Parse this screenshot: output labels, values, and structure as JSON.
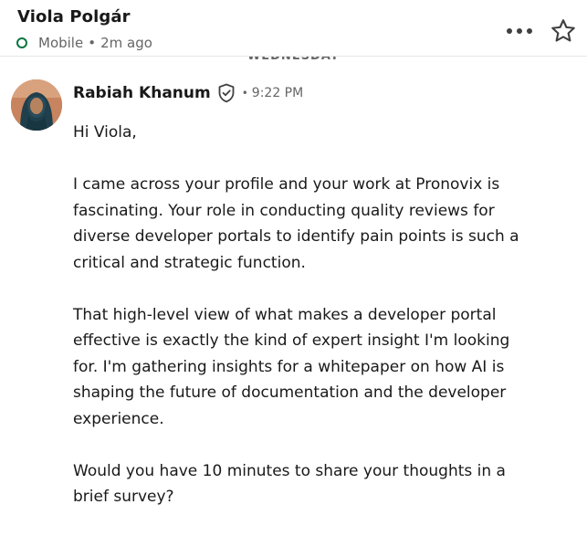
{
  "header": {
    "contact_name": "Viola Polgár",
    "presence": "Mobile",
    "separator": "•",
    "last_active": "2m ago",
    "more_icon": "more-horizontal-icon",
    "star_icon": "star-icon"
  },
  "divider": {
    "label": "WEDNESDAY"
  },
  "message": {
    "sender": "Rabiah Khanum",
    "verified_icon": "verified-shield-icon",
    "separator": "•",
    "time": "9:22 PM",
    "paragraphs": [
      "Hi Viola,",
      "I came across your profile and your work at Pronovix is fascinating. Your role in conducting quality reviews for diverse developer portals to identify pain points is such a critical and strategic function.",
      "That high-level view of what makes a developer portal effective is exactly the kind of expert insight I'm looking for. I'm gathering insights for a whitepaper on how AI is shaping the future of documentation and the developer experience.",
      "Would you have 10 minutes to share your thoughts in a brief survey?"
    ]
  },
  "colors": {
    "presence_green": "#057642",
    "text_primary": "#191919",
    "text_secondary": "#666666"
  }
}
